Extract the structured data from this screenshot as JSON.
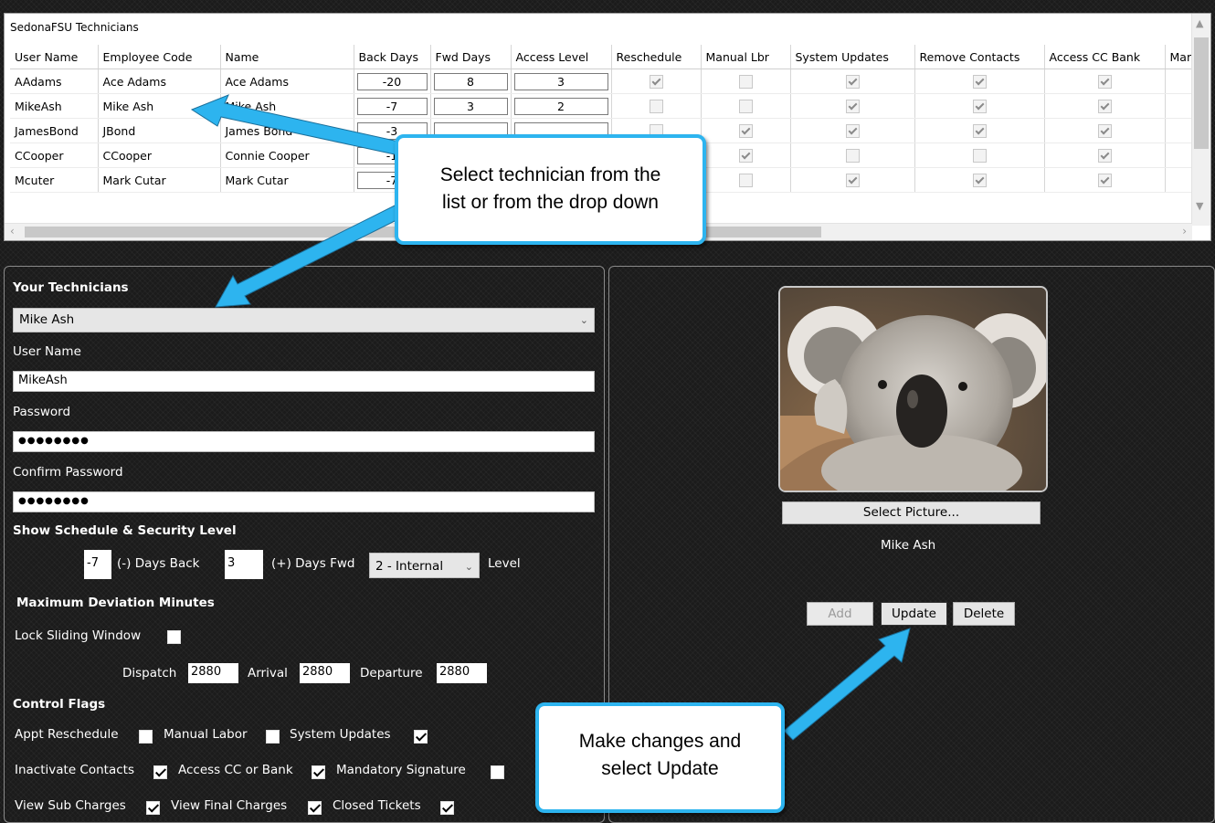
{
  "grid": {
    "title": "SedonaFSU Technicians",
    "columns": [
      "User Name",
      "Employee Code",
      "Name",
      "Back Days",
      "Fwd Days",
      "Access Level",
      "Reschedule",
      "Manual Lbr",
      "System Updates",
      "Remove Contacts",
      "Access CC Bank",
      "Mar"
    ],
    "rows": [
      {
        "user": "AAdams",
        "code": "Ace Adams",
        "name": "Ace Adams",
        "back": "-20",
        "fwd": "8",
        "level": "3",
        "reschedule": true,
        "manual": false,
        "sysupd": true,
        "remove": true,
        "cc": true
      },
      {
        "user": "MikeAsh",
        "code": "Mike Ash",
        "name": "Mike Ash",
        "back": "-7",
        "fwd": "3",
        "level": "2",
        "reschedule": false,
        "manual": false,
        "sysupd": true,
        "remove": true,
        "cc": true
      },
      {
        "user": "JamesBond",
        "code": "JBond",
        "name": "James Bond",
        "back": "-3",
        "fwd": "",
        "level": "",
        "reschedule": false,
        "manual": true,
        "sysupd": true,
        "remove": true,
        "cc": true
      },
      {
        "user": "CCooper",
        "code": "CCooper",
        "name": "Connie Cooper",
        "back": "-1",
        "fwd": "",
        "level": "",
        "reschedule": false,
        "manual": true,
        "sysupd": false,
        "remove": false,
        "cc": true
      },
      {
        "user": "Mcuter",
        "code": "Mark Cutar",
        "name": "Mark Cutar",
        "back": "-7",
        "fwd": "",
        "level": "",
        "reschedule": false,
        "manual": false,
        "sysupd": true,
        "remove": true,
        "cc": true
      }
    ]
  },
  "form": {
    "your_technicians_label": "Your Technicians",
    "technician_selected": "Mike Ash",
    "user_name_label": "User Name",
    "user_name_value": "MikeAsh",
    "password_label": "Password",
    "password_value": "●●●●●●●●",
    "confirm_password_label": "Confirm Password",
    "confirm_password_value": "●●●●●●●●",
    "schedule_label": "Show Schedule & Security Level",
    "days_back_value": "-7",
    "days_back_label": "(-) Days Back",
    "days_fwd_value": "3",
    "days_fwd_label": "(+) Days Fwd",
    "level_selected": "2 - Internal",
    "level_label": "Level",
    "deviation_label": "Maximum Deviation Minutes",
    "lock_sliding_label": "Lock Sliding Window",
    "lock_sliding_checked": false,
    "dispatch_label": "Dispatch",
    "dispatch_value": "2880",
    "arrival_label": "Arrival",
    "arrival_value": "2880",
    "departure_label": "Departure",
    "departure_value": "2880",
    "control_flags_label": "Control Flags",
    "flags": {
      "appt_reschedule": {
        "label": "Appt Reschedule",
        "checked": false
      },
      "manual_labor": {
        "label": "Manual Labor",
        "checked": false
      },
      "system_updates": {
        "label": "System Updates",
        "checked": true
      },
      "inactivate_contacts": {
        "label": "Inactivate Contacts",
        "checked": true
      },
      "access_cc_bank": {
        "label": "Access CC or Bank",
        "checked": true
      },
      "mandatory_signature": {
        "label": "Mandatory Signature",
        "checked": false
      },
      "view_sub_charges": {
        "label": "View Sub Charges",
        "checked": true
      },
      "view_final_charges": {
        "label": "View Final Charges",
        "checked": true
      },
      "closed_tickets": {
        "label": "Closed Tickets",
        "checked": true
      }
    }
  },
  "picture": {
    "select_label": "Select Picture...",
    "caption": "Mike Ash"
  },
  "buttons": {
    "add": "Add",
    "update": "Update",
    "delete": "Delete"
  },
  "callouts": {
    "select_technician": [
      "Select technician from the",
      "list or from the drop down"
    ],
    "make_changes": [
      "Make changes and",
      "select Update"
    ]
  },
  "colors": {
    "callout_border": "#2db4ef",
    "background": "#1b1b1b"
  }
}
